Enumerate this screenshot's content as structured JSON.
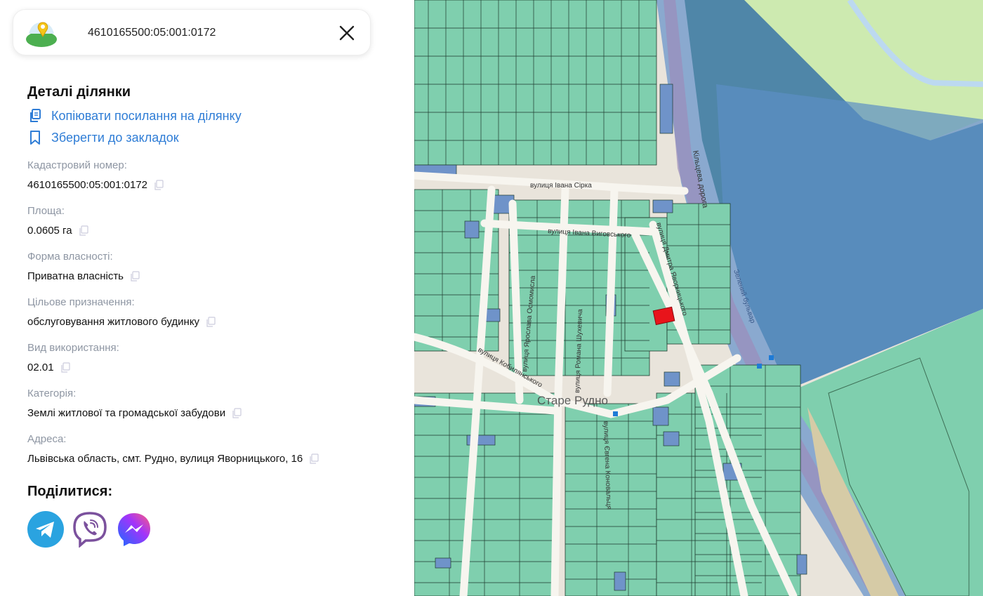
{
  "search": {
    "query": "4610165500:05:001:0172"
  },
  "details": {
    "title": "Деталі ділянки",
    "copy_link_label": "Копіювати посилання на ділянку",
    "bookmark_label": "Зберегти до закладок",
    "fields": [
      {
        "label": "Кадастровий номер:",
        "value": "4610165500:05:001:0172"
      },
      {
        "label": "Площа:",
        "value": "0.0605 га"
      },
      {
        "label": "Форма власності:",
        "value": "Приватна власність"
      },
      {
        "label": "Цільове призначення:",
        "value": "обслуговування житлового будинку"
      },
      {
        "label": "Вид використання:",
        "value": "02.01"
      },
      {
        "label": "Категорія:",
        "value": "Землі житлової та громадської забудови"
      },
      {
        "label": "Адреса:",
        "value": "Львівська область, смт. Рудно, вулиця Яворницького, 16"
      }
    ]
  },
  "share": {
    "title": "Поділитися:",
    "buttons": [
      "telegram-icon",
      "viber-icon",
      "messenger-icon"
    ]
  },
  "map": {
    "place_label": "Старе Рудно",
    "streets": [
      "вулиця Івана Сірка",
      "вулиця Івана Виговського",
      "вулиця Дмитра Яворницького",
      "Кільцева дорога",
      "вулиця Ярослава Осмомисла",
      "вулиця Романа Шухевича",
      "вулиця Євгена Коновальця",
      "вулиця Кобилянського",
      "Зелений бульвар"
    ],
    "colors": {
      "parcel": "#7fcfae",
      "parcel_blue": "#6f93c9",
      "selected_parcel": "#e8141b",
      "road": "#f7f5ef",
      "water_area": "#4f86a8",
      "meadow": "#cdeab0",
      "link": "#2f7dd6"
    }
  }
}
